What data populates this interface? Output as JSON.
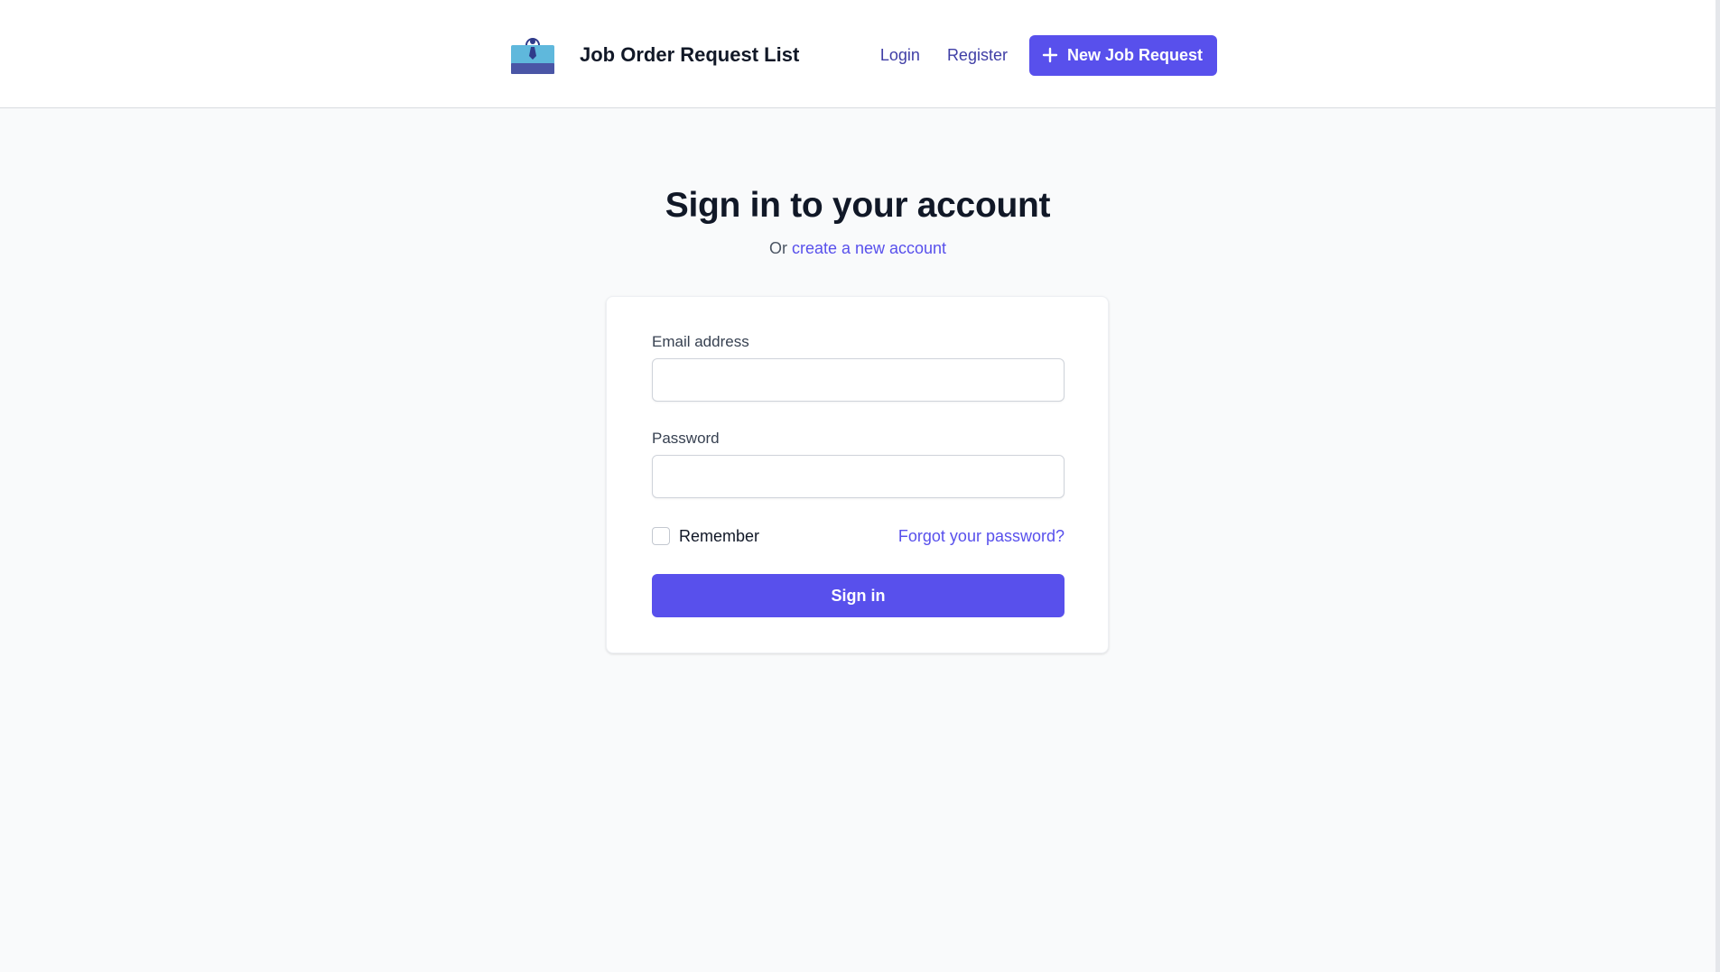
{
  "header": {
    "logo_icon": "briefcase-person-icon",
    "title": "Job Order Request List",
    "nav": {
      "login": "Login",
      "register": "Register",
      "new_job_request": "New Job Request",
      "new_job_icon": "plus-icon"
    }
  },
  "main": {
    "heading": "Sign in to your account",
    "sub_prefix": "Or",
    "sub_link": "create a new account"
  },
  "form": {
    "email_label": "Email address",
    "email_value": "",
    "password_label": "Password",
    "password_value": "",
    "remember_label": "Remember",
    "remember_checked": false,
    "forgot_link": "Forgot your password?",
    "submit_label": "Sign in"
  },
  "colors": {
    "accent": "#5850ec",
    "nav_link": "#3f3ea6",
    "background": "#f9fafb",
    "card": "#ffffff",
    "heading": "#111827"
  }
}
